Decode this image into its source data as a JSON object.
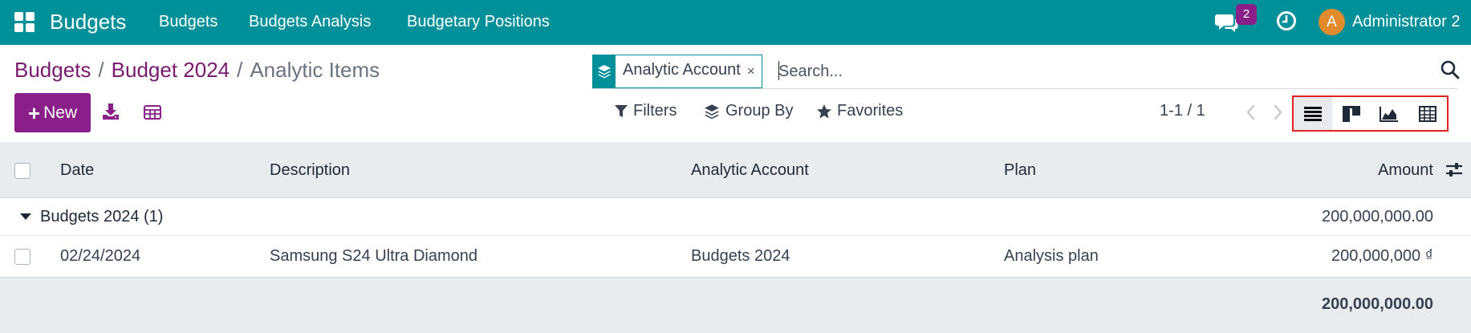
{
  "navbar": {
    "app_name": "Budgets",
    "menu": [
      "Budgets",
      "Budgets Analysis",
      "Budgetary Positions"
    ],
    "messages_count": "2",
    "avatar_letter": "A",
    "user_name": "Administrator 2",
    "bg_color": "#00909a",
    "icons": [
      "apps-grid-icon",
      "chat-icon",
      "clock-icon"
    ]
  },
  "breadcrumb": {
    "items": [
      "Budgets",
      "Budget 2024"
    ],
    "separator": "/",
    "current": "Analytic Items"
  },
  "search": {
    "facet_label": "Analytic Account",
    "facet_remove": "×",
    "placeholder": "Search..."
  },
  "toolbar": {
    "new_label": "New",
    "filters_label": "Filters",
    "group_by_label": "Group By",
    "favorites_label": "Favorites",
    "pager": "1-1 / 1",
    "views": [
      "list-view",
      "kanban-view",
      "graph-view",
      "pivot-view"
    ],
    "active_view": "list-view",
    "accent_color": "#8a1f89"
  },
  "table": {
    "columns": [
      "Date",
      "Description",
      "Analytic Account",
      "Plan",
      "Amount"
    ],
    "group": {
      "label": "Budgets 2024 (1)",
      "total": "200,000,000.00"
    },
    "rows": [
      {
        "date": "02/24/2024",
        "description": "Samsung S24 Ultra Diamond",
        "analytic_account": "Budgets 2024",
        "plan": "Analysis plan",
        "amount": "200,000,000 ₫"
      }
    ],
    "footer_total": "200,000,000.00"
  }
}
